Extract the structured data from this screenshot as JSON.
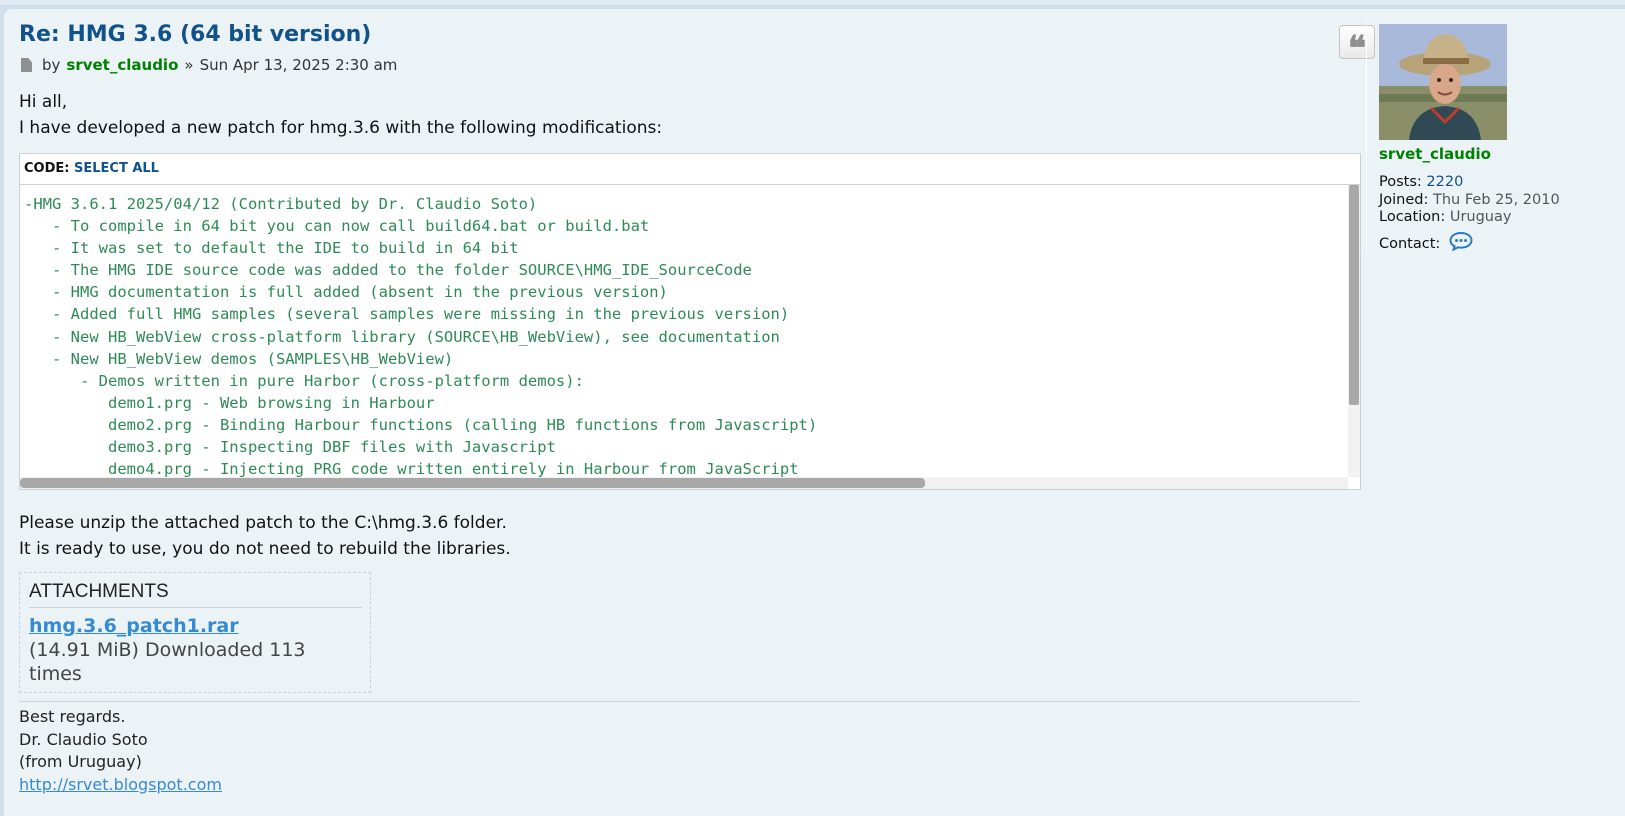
{
  "post": {
    "title": "Re: HMG 3.6 (64 bit version)",
    "meta": {
      "by": "by",
      "author": "srvet_claudio",
      "separator": "»",
      "date": "Sun Apr 13, 2025 2:30 am"
    },
    "intro": [
      "Hi all,",
      "I have developed a new patch for hmg.3.6 with the following modifications:"
    ],
    "code": {
      "label": "CODE:",
      "select_all": "SELECT ALL",
      "text": "-HMG 3.6.1 2025/04/12 (Contributed by Dr. Claudio Soto)\n   - To compile in 64 bit you can now call build64.bat or build.bat\n   - It was set to default the IDE to build in 64 bit\n   - The HMG IDE source code was added to the folder SOURCE\\HMG_IDE_SourceCode\n   - HMG documentation is full added (absent in the previous version)\n   - Added full HMG samples (several samples were missing in the previous version)\n   - New HB_WebView cross-platform library (SOURCE\\HB_WebView), see documentation\n   - New HB_WebView demos (SAMPLES\\HB_WebView)\n      - Demos written in pure Harbor (cross-platform demos):\n         demo1.prg - Web browsing in Harbour\n         demo2.prg - Binding Harbour functions (calling HB functions from Javascript)\n         demo3.prg - Inspecting DBF files with Javascript\n         demo4.prg - Injecting PRG code written entirely in Harbour from JavaScript"
    },
    "after": [
      "Please unzip the attached patch to the C:\\hmg.3.6 folder.",
      "It is ready to use, you do not need to rebuild the libraries."
    ],
    "attachments": {
      "title": "ATTACHMENTS",
      "file_name": "hmg.3.6_patch1.rar",
      "file_info": "(14.91 MiB) Downloaded 113 times"
    },
    "signature": {
      "lines": [
        "Best regards.",
        "Dr. Claudio Soto",
        "(from Uruguay)"
      ],
      "link": "http://srvet.blogspot.com"
    }
  },
  "profile": {
    "username": "srvet_claudio",
    "posts_label": "Posts:",
    "posts_value": "2220",
    "joined_label": "Joined:",
    "joined_value": "Thu Feb 25, 2010",
    "location_label": "Location:",
    "location_value": "Uruguay",
    "contact_label": "Contact:"
  },
  "colors": {
    "title": "#105289",
    "username": "#008000",
    "code_text": "#2e8b57",
    "link": "#368ad2",
    "post_background": "#ecf3f7"
  },
  "icons": {
    "post": "page-icon",
    "quote": "quote-icon",
    "contact": "speech-bubble-icon"
  }
}
